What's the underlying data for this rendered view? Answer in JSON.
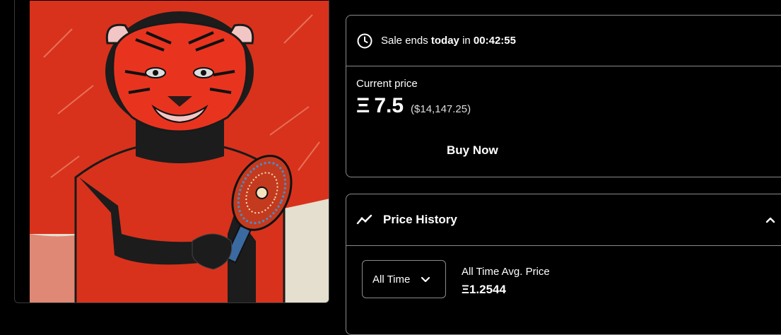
{
  "artwork": {
    "description_icon": "tiger-mask-portrait"
  },
  "sale": {
    "prefix": "Sale ends ",
    "day": "today",
    "mid": " in ",
    "countdown": "00:42:55",
    "icon": "clock-icon"
  },
  "price": {
    "label": "Current price",
    "currency_symbol": "Ξ",
    "value": "7.5",
    "usd": "($14,147.25)"
  },
  "buy": {
    "label": "Buy Now"
  },
  "history": {
    "title": "Price History",
    "icon": "trend-icon",
    "range_select": "All Time",
    "avg_label": "All Time Avg. Price",
    "avg_value": "Ξ1.2544"
  }
}
